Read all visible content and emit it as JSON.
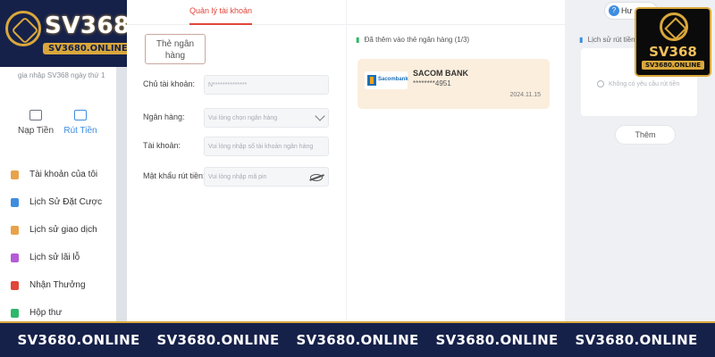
{
  "brand": {
    "name": "SV368",
    "url_badge": "SV3680.ONLINE"
  },
  "badge": {
    "name": "SV368",
    "url": "SV3680.ONLINE"
  },
  "sidebar": {
    "join_info": "gia nhập SV368 ngày thứ 1",
    "quick_actions": [
      {
        "label": "Nạp Tiền"
      },
      {
        "label": "Rút Tiền"
      }
    ],
    "items": [
      {
        "label": "Tài khoản của tôi",
        "icon": "user-icon",
        "color": "#e8a24a"
      },
      {
        "label": "Lịch Sử Đặt Cược",
        "icon": "list-icon",
        "color": "#3f8de0"
      },
      {
        "label": "Lịch sử giao dịch",
        "icon": "receipt-icon",
        "color": "#e8a24a"
      },
      {
        "label": "Lịch sử lãi lỗ",
        "icon": "chart-icon",
        "color": "#b45cd6"
      },
      {
        "label": "Nhận Thưởng",
        "icon": "gift-icon",
        "color": "#e0463a"
      },
      {
        "label": "Hộp thư",
        "icon": "mail-icon",
        "color": "#2eb86a"
      }
    ]
  },
  "main": {
    "active_tab": "Quản lý tài khoản",
    "bank_tab": "Thẻ ngân hàng",
    "form": {
      "holder_label": "Chủ tài khoản:",
      "holder_value": "N**************",
      "bank_label": "Ngân hàng:",
      "bank_placeholder": "Vui lòng chọn ngân hàng",
      "account_label": "Tài khoản:",
      "account_placeholder": "Vui lòng nhập số tài khoản ngân hàng",
      "pin_label": "Mật khẩu rút tiền:",
      "pin_placeholder": "Vui lòng nhập mã pin"
    },
    "added": {
      "title": "Đã thêm vào thẻ ngân hàng",
      "count": "(1/3)",
      "card": {
        "logo_text": "Sacombank",
        "bank_name": "SACOM BANK",
        "number": "********4951",
        "date": "2024.11.15"
      }
    }
  },
  "right": {
    "help_label": "Hư",
    "history_title": "Lịch sử rút tiền",
    "empty_text": "Không có yêu cầu rút tiền",
    "more_label": "Thêm"
  },
  "footer": {
    "items": [
      "SV3680.ONLINE",
      "SV3680.ONLINE",
      "SV3680.ONLINE",
      "SV3680.ONLINE",
      "SV3680.ONLINE"
    ]
  },
  "colors": {
    "navy": "#16214a",
    "gold": "#d9a73b",
    "accent_red": "#e0463a",
    "link_blue": "#3f8de0",
    "card_bg": "#fbeedd"
  }
}
